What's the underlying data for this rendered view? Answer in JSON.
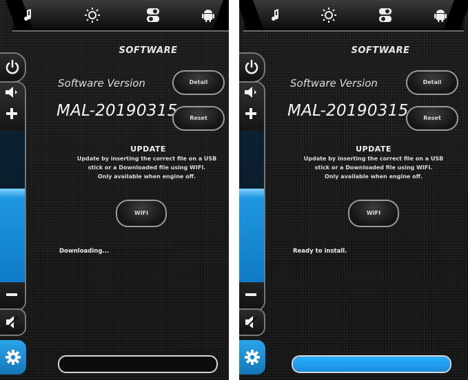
{
  "screens": [
    {
      "id": "left",
      "title": "SOFTWARE",
      "software_version_label": "Software Version",
      "software_version_value": "MAL-20190315",
      "detail_label": "Detail",
      "reset_label": "Reset",
      "update_title": "UPDATE",
      "update_description_lines": [
        "Update by inserting the correct file on a USB",
        "stick or a Downloaded file using WIFI.",
        "Only available when engine off."
      ],
      "wifi_label": "WIFI",
      "status_text": "Downloading...",
      "volume_level": 0.62,
      "progress": 0.0,
      "tabs": [
        "music-note-icon",
        "sun-icon",
        "toggle-switch-icon",
        "android-icon"
      ]
    },
    {
      "id": "right",
      "title": "SOFTWARE",
      "software_version_label": "Software Version",
      "software_version_value": "MAL-20190315",
      "detail_label": "Detail",
      "reset_label": "Reset",
      "update_title": "UPDATE",
      "update_description_lines": [
        "Update by inserting the correct file on a USB",
        "stick or a Downloaded file using WIFI.",
        "Only available when engine off."
      ],
      "wifi_label": "WIFI",
      "status_text": "Ready to install.",
      "volume_level": 0.62,
      "progress": 1.0,
      "tabs": [
        "music-note-icon",
        "sun-icon",
        "toggle-switch-icon",
        "android-icon"
      ]
    }
  ],
  "colors": {
    "accent": "#1f97e0",
    "background": "#161616",
    "text": "#e8e8e8"
  }
}
